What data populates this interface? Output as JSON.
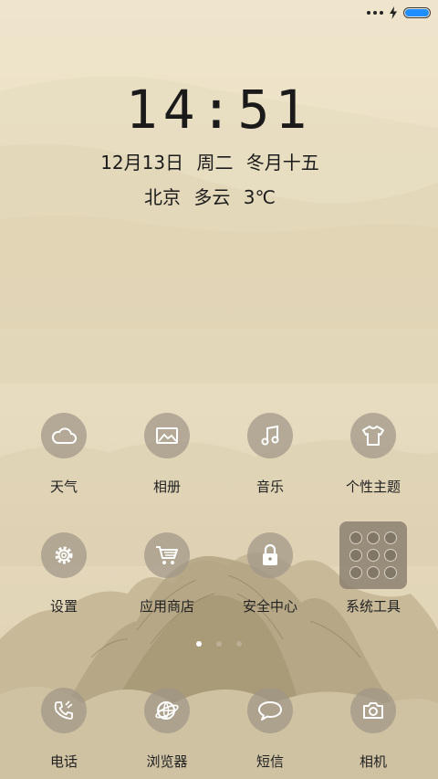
{
  "status_bar": {
    "icons": [
      "more-dots-icon",
      "charging-bolt-icon",
      "battery-icon"
    ],
    "battery_level": 1.0,
    "battery_color": "#1f8fff"
  },
  "lockscreen": {
    "time": "14:51",
    "date": "12月13日 周二 冬月十五",
    "weather": "北京 多云 3℃"
  },
  "apps": {
    "weather": {
      "label": "天气",
      "icon": "cloud-icon"
    },
    "gallery": {
      "label": "相册",
      "icon": "image-icon"
    },
    "music": {
      "label": "音乐",
      "icon": "music-note-icon"
    },
    "themes": {
      "label": "个性主题",
      "icon": "tshirt-icon"
    },
    "settings": {
      "label": "设置",
      "icon": "gear-icon"
    },
    "app_store": {
      "label": "应用商店",
      "icon": "shopping-cart-icon"
    },
    "security": {
      "label": "安全中心",
      "icon": "lock-icon"
    },
    "tools_folder": {
      "label": "系统工具",
      "icon": "folder-icon"
    },
    "phone": {
      "label": "电话",
      "icon": "phone-icon"
    },
    "browser": {
      "label": "浏览器",
      "icon": "globe-icon"
    },
    "messages": {
      "label": "短信",
      "icon": "chat-bubble-icon"
    },
    "camera": {
      "label": "相机",
      "icon": "camera-icon"
    }
  },
  "pager": {
    "count": 3,
    "active_index": 0,
    "active_color": "#ffffff",
    "inactive_color": "#b9ad94"
  },
  "colors": {
    "icon_circle": "#a09687",
    "text": "#1b1b1b",
    "bg": "#ebe0c4"
  }
}
